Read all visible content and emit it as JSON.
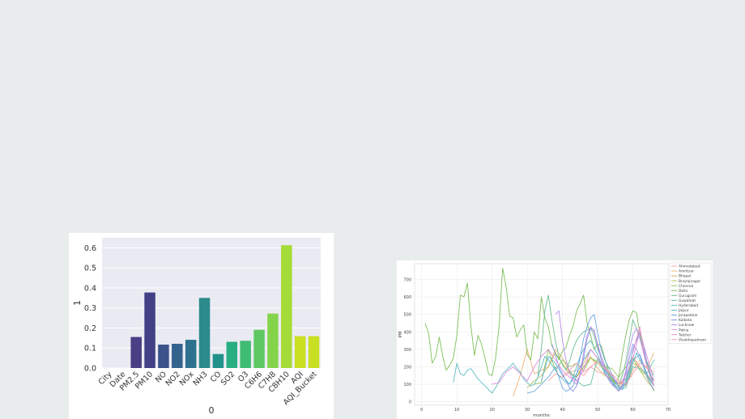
{
  "chart_data": [
    {
      "type": "bar",
      "categories": [
        "City",
        "Date",
        "PM2.5",
        "PM10",
        "NO",
        "NO2",
        "NOx",
        "NH3",
        "CO",
        "SO2",
        "O3",
        "C6H6",
        "C7H8",
        "C8H10",
        "AQI",
        "AQI_Bucket"
      ],
      "values": [
        0.0,
        0.0,
        0.155,
        0.377,
        0.117,
        0.121,
        0.141,
        0.35,
        0.07,
        0.131,
        0.136,
        0.191,
        0.272,
        0.613,
        0.159,
        0.159
      ],
      "colors": [
        "#48186a",
        "#472d7b",
        "#4b3e85",
        "#424086",
        "#3b528b",
        "#33638d",
        "#2c728e",
        "#2a8a8c",
        "#21918c",
        "#28ae80",
        "#3fbc73",
        "#5ec962",
        "#84d44b",
        "#a5db36",
        "#c8e020",
        "#c9df22"
      ],
      "xlabel": "0",
      "ylabel": "1",
      "yticks": [
        "0.0",
        "0.1",
        "0.2",
        "0.3",
        "0.4",
        "0.5",
        "0.6"
      ],
      "ylim": [
        0,
        0.65
      ],
      "grid": true
    },
    {
      "type": "line",
      "xlabel": "months",
      "ylabel": "PM",
      "xticks": [
        "0",
        "10",
        "20",
        "30",
        "40",
        "50",
        "60",
        "70"
      ],
      "yticks": [
        "0",
        "100",
        "200",
        "300",
        "400",
        "500",
        "600",
        "700"
      ],
      "xlim": [
        -2,
        70
      ],
      "ylim": [
        -20,
        790
      ],
      "grid": true,
      "legend_position": "top-right",
      "series": [
        {
          "name": "Ahmedabad",
          "color": "#f4a3a3",
          "x": [
            36,
            38,
            40,
            42,
            44,
            46,
            48,
            50,
            52,
            54,
            56,
            58,
            60,
            62,
            64,
            66
          ],
          "y": [
            120,
            160,
            140,
            170,
            180,
            150,
            200,
            170,
            160,
            120,
            100,
            130,
            260,
            200,
            150,
            120
          ]
        },
        {
          "name": "Amritsar",
          "color": "#f2b27a",
          "x": [
            26,
            28,
            30,
            32,
            34,
            36,
            38,
            40,
            42,
            44,
            46,
            48,
            50,
            52,
            54,
            56,
            58,
            60,
            62,
            64,
            66
          ],
          "y": [
            30,
            150,
            300,
            160,
            180,
            200,
            300,
            250,
            170,
            140,
            200,
            260,
            190,
            150,
            130,
            110,
            90,
            180,
            240,
            190,
            280
          ]
        },
        {
          "name": "Bhopal",
          "color": "#d2b35c",
          "x": [
            44,
            46,
            48,
            50,
            52,
            54,
            56,
            58,
            60,
            62,
            64,
            66
          ],
          "y": [
            140,
            220,
            300,
            250,
            180,
            150,
            80,
            110,
            220,
            200,
            150,
            100
          ]
        },
        {
          "name": "Brajrajnagar",
          "color": "#b3be5c",
          "x": [
            30,
            32,
            34,
            36,
            38,
            40,
            42,
            44,
            46,
            48,
            50,
            52,
            54,
            56,
            58,
            60,
            62,
            64,
            66
          ],
          "y": [
            80,
            120,
            150,
            200,
            280,
            220,
            160,
            140,
            200,
            250,
            220,
            180,
            130,
            90,
            130,
            250,
            180,
            120,
            70
          ]
        },
        {
          "name": "Chennai",
          "color": "#95c35c",
          "x": [
            32,
            34,
            36,
            38,
            40,
            42,
            44,
            46,
            48,
            50,
            52,
            54,
            56,
            58,
            60,
            62,
            64,
            66
          ],
          "y": [
            100,
            110,
            300,
            180,
            240,
            200,
            220,
            180,
            250,
            230,
            200,
            190,
            140,
            200,
            250,
            180,
            150,
            60
          ]
        },
        {
          "name": "Delhi",
          "color": "#7fbf5a",
          "x": [
            1,
            2,
            3,
            4,
            5,
            6,
            7,
            8,
            9,
            10,
            11,
            12,
            13,
            14,
            15,
            16,
            17,
            18,
            19,
            20,
            21,
            22,
            23,
            24,
            25,
            26,
            27,
            28,
            29,
            30,
            31,
            32,
            33,
            34,
            35,
            36,
            37,
            38,
            39,
            40,
            41,
            42,
            43,
            44,
            45,
            46,
            47,
            48,
            49,
            50,
            51,
            52,
            53,
            54,
            55,
            56,
            57,
            58,
            59,
            60,
            61,
            62,
            63,
            64,
            65,
            66
          ],
          "y": [
            450,
            390,
            220,
            260,
            370,
            260,
            180,
            210,
            250,
            380,
            610,
            600,
            680,
            430,
            265,
            380,
            330,
            250,
            160,
            150,
            250,
            430,
            765,
            660,
            490,
            480,
            370,
            410,
            440,
            270,
            240,
            400,
            360,
            600,
            480,
            430,
            320,
            280,
            240,
            290,
            310,
            380,
            430,
            520,
            560,
            610,
            450,
            380,
            300,
            330,
            320,
            250,
            180,
            130,
            100,
            140,
            270,
            380,
            470,
            520,
            510,
            390,
            300,
            220,
            150,
            120
          ]
        },
        {
          "name": "Gurugram",
          "color": "#6dbd8e",
          "x": [
            33,
            34,
            35,
            36,
            37,
            38,
            39,
            40,
            41,
            42,
            43,
            44,
            45,
            46,
            47,
            48,
            49,
            50,
            51,
            52,
            53,
            54,
            55,
            56,
            57,
            58,
            59,
            60,
            61,
            62,
            63,
            64,
            65,
            66
          ],
          "y": [
            150,
            300,
            520,
            610,
            470,
            350,
            260,
            210,
            180,
            230,
            300,
            350,
            380,
            400,
            410,
            420,
            380,
            300,
            260,
            210,
            170,
            150,
            120,
            100,
            150,
            230,
            350,
            470,
            420,
            380,
            300,
            230,
            180,
            150
          ]
        },
        {
          "name": "Guwahati",
          "color": "#63c0a8",
          "x": [
            42,
            44,
            46,
            48,
            50,
            52,
            54,
            56,
            58,
            60,
            62,
            64,
            66
          ],
          "y": [
            180,
            120,
            90,
            100,
            250,
            160,
            110,
            70,
            80,
            200,
            190,
            160,
            240
          ]
        },
        {
          "name": "Hyderabad",
          "color": "#5ebdc0",
          "x": [
            9,
            10,
            11,
            12,
            13,
            14,
            15,
            16,
            17,
            18,
            19,
            20,
            21,
            22,
            23,
            24,
            25,
            26,
            27,
            28,
            29,
            30,
            31,
            32,
            33,
            34,
            35,
            36,
            37,
            38,
            39,
            40,
            41,
            42,
            43,
            44,
            45,
            46,
            47,
            48,
            49,
            50,
            51,
            52,
            53,
            54,
            55,
            56,
            57,
            58,
            59,
            60,
            61,
            62,
            63,
            64,
            65,
            66
          ],
          "y": [
            110,
            220,
            160,
            150,
            180,
            190,
            160,
            130,
            110,
            90,
            70,
            50,
            80,
            120,
            160,
            180,
            200,
            220,
            190,
            170,
            130,
            110,
            90,
            100,
            140,
            200,
            260,
            240,
            210,
            180,
            150,
            130,
            110,
            100,
            140,
            200,
            260,
            300,
            330,
            350,
            310,
            270,
            220,
            190,
            160,
            140,
            110,
            90,
            80,
            100,
            150,
            220,
            280,
            240,
            200,
            160,
            120,
            90
          ]
        },
        {
          "name": "Jaipur",
          "color": "#5fb3d6",
          "x": [
            34,
            36,
            38,
            40,
            42,
            44,
            46,
            48,
            50,
            52,
            54,
            56,
            58,
            60,
            62,
            64,
            66
          ],
          "y": [
            120,
            260,
            220,
            150,
            100,
            160,
            240,
            300,
            250,
            180,
            120,
            70,
            110,
            240,
            270,
            160,
            90
          ]
        },
        {
          "name": "Jorapokhar",
          "color": "#6aa6e3",
          "x": [
            30,
            32,
            34,
            36,
            38,
            40,
            41,
            42,
            43,
            44,
            45,
            46,
            47,
            48,
            49,
            50,
            51,
            52,
            53,
            54,
            55,
            56,
            57,
            58,
            59,
            60,
            61,
            62,
            63,
            64,
            65,
            66
          ],
          "y": [
            50,
            60,
            100,
            140,
            200,
            80,
            60,
            70,
            90,
            150,
            250,
            360,
            430,
            480,
            500,
            390,
            300,
            240,
            200,
            160,
            120,
            80,
            70,
            120,
            200,
            300,
            350,
            400,
            330,
            220,
            160,
            90
          ]
        },
        {
          "name": "Kolkata",
          "color": "#8b98e6",
          "x": [
            37,
            38,
            39,
            40,
            41,
            42,
            43,
            44,
            45,
            46,
            47,
            48,
            49,
            50,
            51,
            52,
            53,
            54,
            55,
            56,
            57,
            58,
            59,
            60,
            61,
            62,
            63,
            64,
            65,
            66
          ],
          "y": [
            330,
            270,
            200,
            160,
            120,
            80,
            60,
            90,
            150,
            250,
            360,
            420,
            410,
            320,
            240,
            170,
            130,
            100,
            80,
            60,
            90,
            160,
            250,
            330,
            300,
            260,
            200,
            140,
            100,
            70
          ]
        },
        {
          "name": "Lucknow",
          "color": "#b68ee8",
          "x": [
            38,
            39,
            40,
            41,
            42,
            43,
            44,
            45,
            46,
            47,
            48,
            49,
            50,
            51,
            52,
            53,
            54,
            55,
            56,
            57,
            58,
            59,
            60,
            61,
            62,
            63,
            64,
            65,
            66
          ],
          "y": [
            500,
            520,
            350,
            240,
            170,
            120,
            100,
            160,
            280,
            380,
            430,
            400,
            330,
            260,
            200,
            150,
            110,
            80,
            60,
            100,
            180,
            300,
            380,
            420,
            360,
            280,
            200,
            140,
            90
          ]
        },
        {
          "name": "Patna",
          "color": "#dd8ee0",
          "x": [
            20,
            22,
            24,
            26,
            28,
            30,
            32,
            34,
            36,
            38,
            40,
            42,
            44,
            46,
            48,
            50,
            52,
            54,
            56,
            58,
            60,
            62,
            64,
            66
          ],
          "y": [
            100,
            110,
            170,
            200,
            160,
            120,
            200,
            260,
            300,
            240,
            180,
            140,
            120,
            180,
            300,
            250,
            200,
            150,
            100,
            150,
            250,
            400,
            260,
            120
          ]
        },
        {
          "name": "Talcher",
          "color": "#ef8fc7",
          "x": [
            60,
            61,
            62,
            63,
            64,
            65,
            66
          ],
          "y": [
            280,
            360,
            430,
            300,
            200,
            140,
            90
          ]
        },
        {
          "name": "Visakhapatnam",
          "color": "#f49db2",
          "x": [
            40,
            42,
            44,
            46,
            48,
            50,
            52,
            54,
            56,
            58,
            60,
            62,
            64,
            66
          ],
          "y": [
            150,
            180,
            220,
            170,
            200,
            230,
            190,
            160,
            120,
            100,
            160,
            220,
            200,
            170
          ]
        }
      ]
    }
  ]
}
